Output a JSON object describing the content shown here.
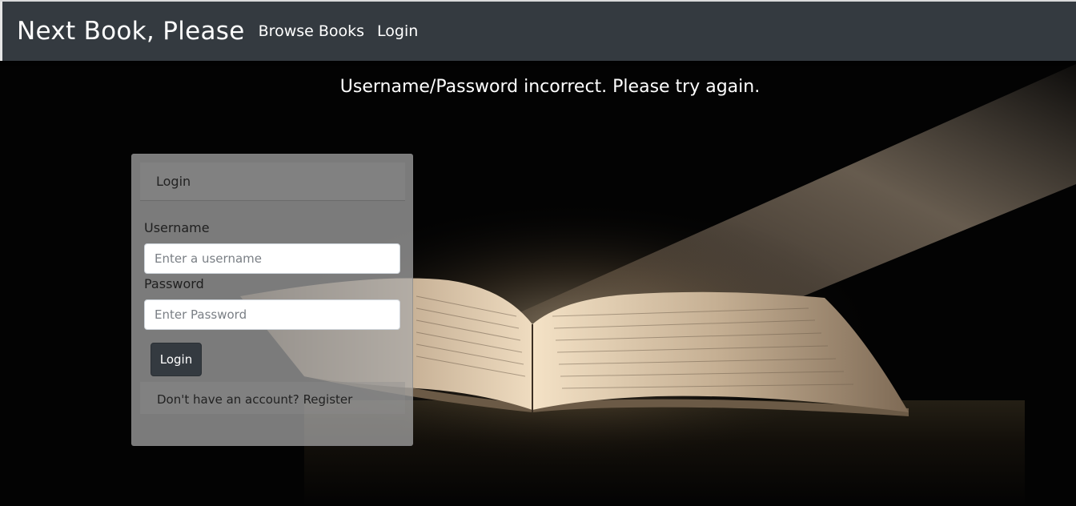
{
  "navbar": {
    "brand": "Next Book, Please",
    "links": [
      {
        "label": "Browse Books"
      },
      {
        "label": "Login"
      }
    ],
    "background_color": "#343a40"
  },
  "error_message": "Username/Password incorrect. Please try again.",
  "login_card": {
    "header": "Login",
    "username_label": "Username",
    "username_placeholder": "Enter a username",
    "username_value": "",
    "password_label": "Password",
    "password_placeholder": "Enter Password",
    "password_value": "",
    "submit_label": "Login",
    "register_prompt": "Don't have an account?",
    "register_link": "Register"
  },
  "background": {
    "icon": "open-book-with-light-beam"
  }
}
